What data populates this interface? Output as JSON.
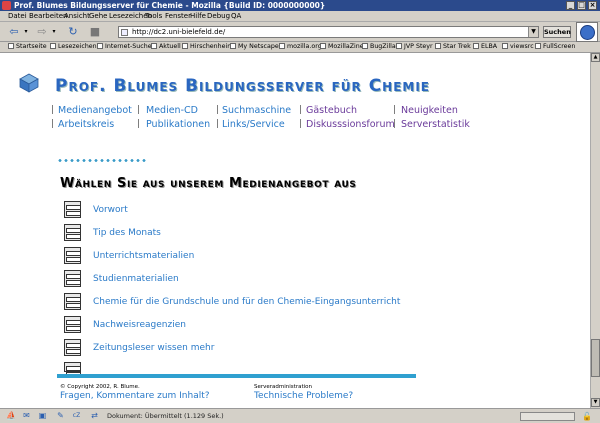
{
  "window": {
    "title": "Prof. Blumes Bildungsserver für Chemie - Mozilla {Build ID: 0000000000}"
  },
  "menu": [
    "Datei",
    "Bearbeiten",
    "Ansicht",
    "Gehe",
    "Lesezeichen",
    "Tools",
    "Fenster",
    "Hilfe",
    "Debug",
    "QA"
  ],
  "nav": {
    "url": "http://dc2.uni-bielefeld.de/",
    "search_label": "Suchen"
  },
  "bookmarks": [
    "Startseite",
    "Lesezeichen",
    "Internet-Suche",
    "Aktuell",
    "Hirschenheim",
    "My Netscape",
    "mozilla.org",
    "MozillaZine",
    "BugZilla",
    "JVP Steyr",
    "Star Trek",
    "ELBA",
    "viewsrc",
    "FullScreen"
  ],
  "site": {
    "title": "Prof. Blumes Bildungsserver für Chemie",
    "nav_row1": [
      "Medienangebot",
      "Medien-CD",
      "Suchmaschine",
      "Gästebuch",
      "Neuigkeiten"
    ],
    "nav_row2": [
      "Arbeitskreis",
      "Publikationen",
      "Links/Service",
      "Diskusssionsforum",
      "Serverstatistik"
    ]
  },
  "section": {
    "title": "Wählen Sie aus unserem Medienangebot aus",
    "items": [
      "Vorwort",
      "Tip des Monats",
      "Unterrichtsmaterialien",
      "Studienmaterialien",
      "Chemie für die Grundschule und für den Chemie-Eingangsunterricht",
      "Nachweisreagenzien",
      "Zeitungsleser wissen mehr"
    ]
  },
  "footer": {
    "copyright": "© Copyright 2002, R. Blume.",
    "feedback": "Fragen, Kommentare zum Inhalt?",
    "admin_label": "Serveradministration",
    "problems": "Technische Probleme?"
  },
  "status": {
    "text": "Dokument: Übermittelt (1.129 Sek.)"
  },
  "colors": {
    "link": "#2a7ac8",
    "title": "#2a66c0",
    "accent_bar": "#2fa0d0",
    "titlebar": "#2b4a8c"
  }
}
